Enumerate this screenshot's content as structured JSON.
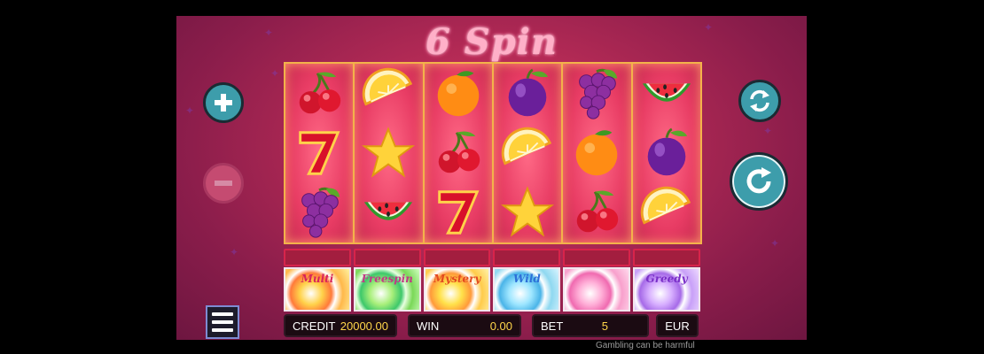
{
  "game": {
    "title": "6 Spin",
    "reels": [
      [
        "cherry",
        "seven",
        "grapes"
      ],
      [
        "lemon",
        "star",
        "watermelon"
      ],
      [
        "orange",
        "cherry",
        "seven"
      ],
      [
        "plum",
        "lemon",
        "star"
      ],
      [
        "grapes",
        "orange",
        "cherry"
      ],
      [
        "watermelon",
        "plum",
        "lemon"
      ]
    ],
    "features": [
      {
        "label": "Multi",
        "color": "#d7245a"
      },
      {
        "label": "Freespin",
        "color": "#c23a85"
      },
      {
        "label": "Mystery",
        "color": "#e24a20"
      },
      {
        "label": "Wild",
        "color": "#2d6fd8"
      },
      {
        "label": "",
        "color": "#e25aa8"
      },
      {
        "label": "Greedy",
        "color": "#7a2fc8"
      }
    ]
  },
  "controls": {
    "plus_icon": "plus-icon",
    "minus_icon": "minus-icon",
    "autoplay_icon": "autoplay-icon",
    "spin_icon": "spin-icon",
    "menu_icon": "hamburger-icon"
  },
  "status_bar": {
    "credit_label": "CREDIT",
    "credit_value": "20000.00",
    "win_label": "WIN",
    "win_value": "0.00",
    "bet_label": "BET",
    "bet_value": "5",
    "currency": "EUR"
  },
  "footer": {
    "note": "Gambling can be harmful"
  },
  "colors": {
    "accent_frame": "#f3b24a",
    "button_teal": "#3d9dab",
    "credit_value": "#ffd64a"
  }
}
